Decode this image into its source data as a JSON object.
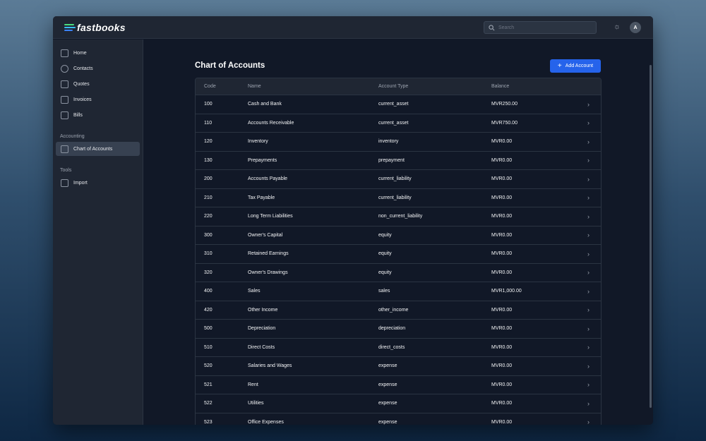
{
  "app": {
    "name": "fastbooks",
    "colors": {
      "accent": "#2563eb",
      "logo_bars": [
        "#4ade80",
        "#38bdf8",
        "#3b82f6"
      ]
    }
  },
  "header": {
    "search_placeholder": "Search",
    "avatar": "A",
    "theme_icon": "sun-icon"
  },
  "sidebar": {
    "items": [
      {
        "label": "Home",
        "icon": "home-icon"
      },
      {
        "label": "Contacts",
        "icon": "users-icon"
      },
      {
        "label": "Quotes",
        "icon": "document-icon"
      },
      {
        "label": "Invoices",
        "icon": "invoice-icon"
      },
      {
        "label": "Bills",
        "icon": "bill-icon"
      }
    ],
    "accounting_label": "Accounting",
    "accounting_items": [
      {
        "label": "Chart of Accounts",
        "icon": "inbox-icon"
      }
    ],
    "tools_label": "Tools",
    "tools_items": [
      {
        "label": "Import",
        "icon": "import-icon"
      }
    ]
  },
  "main": {
    "title": "Chart of Accounts",
    "add_label": "Add Account",
    "columns": [
      "Code",
      "Name",
      "Account Type",
      "Balance"
    ],
    "rows": [
      [
        "100",
        "Cash and Bank",
        "current_asset",
        "MVR250.00"
      ],
      [
        "110",
        "Accounts Receivable",
        "current_asset",
        "MVR750.00"
      ],
      [
        "120",
        "Inventory",
        "inventory",
        "MVR0.00"
      ],
      [
        "130",
        "Prepayments",
        "prepayment",
        "MVR0.00"
      ],
      [
        "200",
        "Accounts Payable",
        "current_liability",
        "MVR0.00"
      ],
      [
        "210",
        "Tax Payable",
        "current_liability",
        "MVR0.00"
      ],
      [
        "220",
        "Long Term Liabilities",
        "non_current_liability",
        "MVR0.00"
      ],
      [
        "300",
        "Owner's Capital",
        "equity",
        "MVR0.00"
      ],
      [
        "310",
        "Retained Earnings",
        "equity",
        "MVR0.00"
      ],
      [
        "320",
        "Owner's Drawings",
        "equity",
        "MVR0.00"
      ],
      [
        "400",
        "Sales",
        "sales",
        "MVR1,000.00"
      ],
      [
        "420",
        "Other Income",
        "other_income",
        "MVR0.00"
      ],
      [
        "500",
        "Depreciation",
        "depreciation",
        "MVR0.00"
      ],
      [
        "510",
        "Direct Costs",
        "direct_costs",
        "MVR0.00"
      ],
      [
        "520",
        "Salaries and Wages",
        "expense",
        "MVR0.00"
      ],
      [
        "521",
        "Rent",
        "expense",
        "MVR0.00"
      ],
      [
        "522",
        "Utilities",
        "expense",
        "MVR0.00"
      ],
      [
        "523",
        "Office Expenses",
        "expense",
        "MVR0.00"
      ]
    ]
  }
}
